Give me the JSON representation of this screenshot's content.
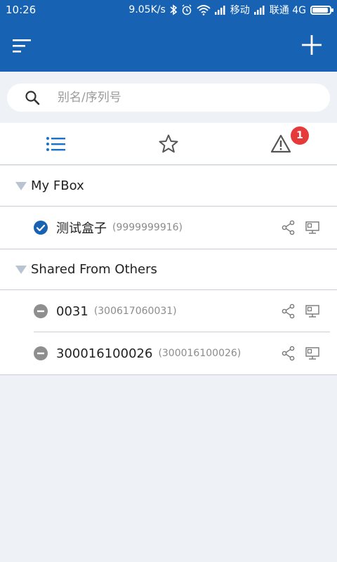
{
  "statusbar": {
    "time": "10:26",
    "speed": "9.05K/s",
    "carrier1": "移动",
    "carrier2": "联通 4G"
  },
  "appbar": {
    "menu_icon": "menu-icon",
    "add_icon": "plus-icon",
    "color": "#1762b3"
  },
  "search": {
    "placeholder": "别名/序列号",
    "value": ""
  },
  "tabs": {
    "items": [
      {
        "icon": "list-icon",
        "active": true
      },
      {
        "icon": "star-icon",
        "active": false
      },
      {
        "icon": "warning-icon",
        "active": false
      }
    ],
    "alarm_badge": "1"
  },
  "groups": [
    {
      "title": "My FBox",
      "devices": [
        {
          "name": "测试盒子",
          "serial": "(9999999916)",
          "status": "online"
        }
      ]
    },
    {
      "title": "Shared From Others",
      "devices": [
        {
          "name": "0031",
          "serial": "(300617060031)",
          "status": "offline"
        },
        {
          "name": "300016100026",
          "serial": "(300016100026)",
          "status": "offline"
        }
      ]
    }
  ],
  "colors": {
    "accent": "#1762b3",
    "badge": "#e5393a",
    "offline": "#8e8e8e"
  }
}
